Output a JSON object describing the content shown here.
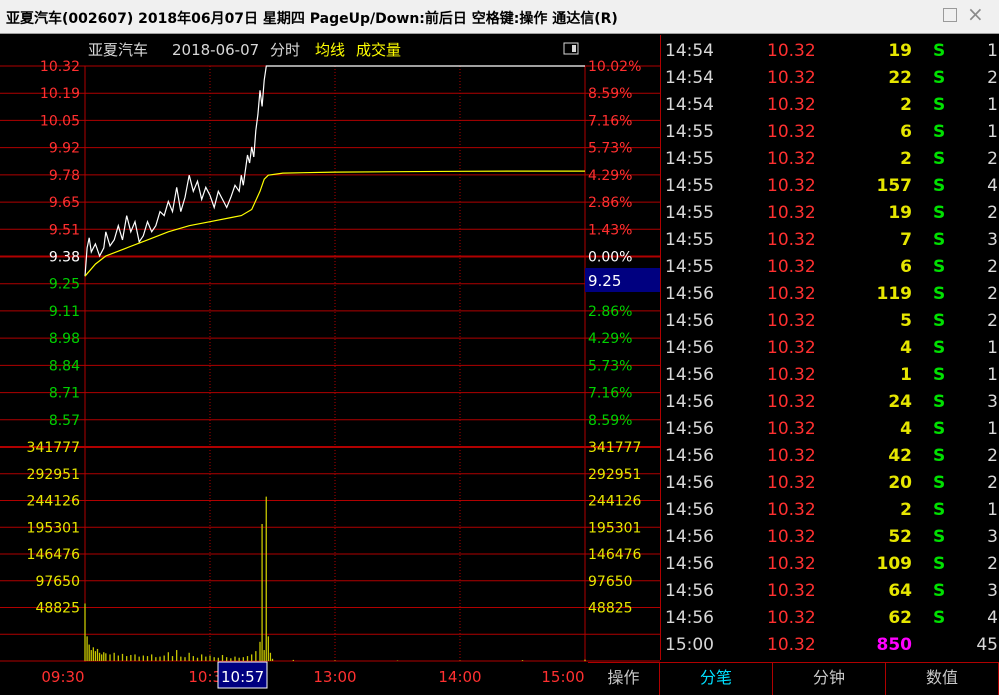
{
  "window": {
    "title": "亚夏汽车(002607) 2018年06月07日 星期四 PageUp/Down:前后日 空格键:操作 通达信(R)",
    "maximize_glyph": "□",
    "close_glyph": "×"
  },
  "chart_header": {
    "stock_name": "亚夏汽车",
    "date": "2018-06-07",
    "mode": "分时",
    "avg_line_label": "均线",
    "volume_label": "成交量"
  },
  "colors": {
    "up": "#ff3030",
    "down": "#00d000",
    "neutral": "#ffffff",
    "avg_line": "#ffff00",
    "grid": "#b00000",
    "volume_bars": "#c8c800",
    "highlight_bg": "#000080",
    "volume_text": "#e6e600",
    "magenta": "#ff00ff"
  },
  "chart_data": {
    "type": "line",
    "title": "亚夏汽车 2018-06-07 分时",
    "prev_close": 9.38,
    "price_ticks_left": [
      "10.32",
      "10.19",
      "10.05",
      "9.92",
      "9.78",
      "9.65",
      "9.51",
      "9.38",
      "9.25",
      "9.11",
      "8.98",
      "8.84",
      "8.71",
      "8.57"
    ],
    "pct_ticks_right": [
      "10.02%",
      "8.59%",
      "7.16%",
      "5.73%",
      "4.29%",
      "2.86%",
      "1.43%",
      "0.00%",
      "1.43%",
      "2.86%",
      "4.29%",
      "5.73%",
      "7.16%",
      "8.59%"
    ],
    "price_range": [
      8.57,
      10.32
    ],
    "volume_ticks": [
      "341777",
      "292951",
      "244126",
      "195301",
      "146476",
      "97650",
      "48825"
    ],
    "volume_range": [
      0,
      390600
    ],
    "time_axis_labels": [
      "09:30",
      "10:30",
      "10:57",
      "13:00",
      "14:00",
      "15:00"
    ],
    "time_axis_minutes": [
      0,
      60,
      87,
      120,
      180,
      240
    ],
    "cursor_time": "10:57",
    "cursor_price": "9.25",
    "series": [
      {
        "name": "price",
        "x": [
          0,
          1,
          2,
          3,
          5,
          7,
          9,
          10,
          12,
          14,
          16,
          18,
          20,
          22,
          24,
          26,
          28,
          30,
          32,
          34,
          36,
          38,
          40,
          42,
          44,
          46,
          48,
          50,
          52,
          54,
          56,
          58,
          60,
          62,
          64,
          66,
          68,
          70,
          72,
          74,
          75,
          76,
          78,
          79,
          80,
          81,
          82,
          83,
          84,
          85,
          86,
          87,
          88,
          240
        ],
        "values": [
          9.28,
          9.42,
          9.47,
          9.4,
          9.44,
          9.38,
          9.42,
          9.5,
          9.43,
          9.46,
          9.53,
          9.46,
          9.58,
          9.5,
          9.55,
          9.45,
          9.48,
          9.55,
          9.5,
          9.53,
          9.6,
          9.58,
          9.65,
          9.6,
          9.72,
          9.6,
          9.67,
          9.78,
          9.7,
          9.75,
          9.66,
          9.72,
          9.68,
          9.62,
          9.7,
          9.66,
          9.62,
          9.67,
          9.73,
          9.7,
          9.78,
          9.73,
          9.88,
          9.84,
          9.92,
          9.87,
          10.0,
          10.08,
          10.2,
          10.12,
          10.25,
          10.32,
          10.32,
          10.32
        ]
      },
      {
        "name": "avg",
        "x": [
          0,
          5,
          10,
          20,
          30,
          40,
          50,
          60,
          70,
          75,
          80,
          84,
          86,
          88,
          95,
          105,
          120,
          150,
          180,
          210,
          240
        ],
        "values": [
          9.28,
          9.34,
          9.38,
          9.42,
          9.46,
          9.5,
          9.53,
          9.55,
          9.57,
          9.58,
          9.61,
          9.7,
          9.76,
          9.78,
          9.79,
          9.792,
          9.795,
          9.797,
          9.799,
          9.8,
          9.8
        ]
      },
      {
        "name": "volume",
        "x": [
          0,
          1,
          2,
          3,
          4,
          5,
          6,
          7,
          8,
          9,
          10,
          12,
          14,
          16,
          18,
          20,
          22,
          24,
          26,
          28,
          30,
          32,
          34,
          36,
          38,
          40,
          42,
          44,
          46,
          48,
          50,
          52,
          54,
          56,
          58,
          60,
          62,
          64,
          66,
          68,
          70,
          72,
          74,
          76,
          78,
          80,
          82,
          84,
          85,
          86,
          87,
          88,
          89,
          90,
          100,
          120,
          150,
          180,
          210,
          240
        ],
        "values": [
          105000,
          45000,
          30000,
          20000,
          25000,
          18000,
          22000,
          15000,
          12000,
          16000,
          14000,
          12000,
          15000,
          10000,
          13000,
          9000,
          11000,
          12000,
          8000,
          10000,
          9000,
          12000,
          7000,
          8000,
          10000,
          16000,
          9000,
          20000,
          8000,
          7000,
          15000,
          9000,
          6000,
          12000,
          8000,
          10000,
          7000,
          6000,
          11000,
          7000,
          5000,
          8000,
          6000,
          7000,
          9000,
          12000,
          18000,
          35000,
          250000,
          20000,
          300000,
          45000,
          15000,
          4000,
          2000,
          1000,
          800,
          600,
          1500,
          2500
        ]
      }
    ]
  },
  "ticks_panel": {
    "rows": [
      {
        "time": "14:54",
        "price": "10.32",
        "volume": "19",
        "dir": "S",
        "count": "1",
        "vcolor": "#e6e600"
      },
      {
        "time": "14:54",
        "price": "10.32",
        "volume": "22",
        "dir": "S",
        "count": "2",
        "vcolor": "#e6e600"
      },
      {
        "time": "14:54",
        "price": "10.32",
        "volume": "2",
        "dir": "S",
        "count": "1",
        "vcolor": "#e6e600"
      },
      {
        "time": "14:55",
        "price": "10.32",
        "volume": "6",
        "dir": "S",
        "count": "1",
        "vcolor": "#e6e600"
      },
      {
        "time": "14:55",
        "price": "10.32",
        "volume": "2",
        "dir": "S",
        "count": "2",
        "vcolor": "#e6e600"
      },
      {
        "time": "14:55",
        "price": "10.32",
        "volume": "157",
        "dir": "S",
        "count": "4",
        "vcolor": "#e6e600"
      },
      {
        "time": "14:55",
        "price": "10.32",
        "volume": "19",
        "dir": "S",
        "count": "2",
        "vcolor": "#e6e600"
      },
      {
        "time": "14:55",
        "price": "10.32",
        "volume": "7",
        "dir": "S",
        "count": "3",
        "vcolor": "#e6e600"
      },
      {
        "time": "14:55",
        "price": "10.32",
        "volume": "6",
        "dir": "S",
        "count": "2",
        "vcolor": "#e6e600"
      },
      {
        "time": "14:56",
        "price": "10.32",
        "volume": "119",
        "dir": "S",
        "count": "2",
        "vcolor": "#e6e600"
      },
      {
        "time": "14:56",
        "price": "10.32",
        "volume": "5",
        "dir": "S",
        "count": "2",
        "vcolor": "#e6e600"
      },
      {
        "time": "14:56",
        "price": "10.32",
        "volume": "4",
        "dir": "S",
        "count": "1",
        "vcolor": "#e6e600"
      },
      {
        "time": "14:56",
        "price": "10.32",
        "volume": "1",
        "dir": "S",
        "count": "1",
        "vcolor": "#e6e600"
      },
      {
        "time": "14:56",
        "price": "10.32",
        "volume": "24",
        "dir": "S",
        "count": "3",
        "vcolor": "#e6e600"
      },
      {
        "time": "14:56",
        "price": "10.32",
        "volume": "4",
        "dir": "S",
        "count": "1",
        "vcolor": "#e6e600"
      },
      {
        "time": "14:56",
        "price": "10.32",
        "volume": "42",
        "dir": "S",
        "count": "2",
        "vcolor": "#e6e600"
      },
      {
        "time": "14:56",
        "price": "10.32",
        "volume": "20",
        "dir": "S",
        "count": "2",
        "vcolor": "#e6e600"
      },
      {
        "time": "14:56",
        "price": "10.32",
        "volume": "2",
        "dir": "S",
        "count": "1",
        "vcolor": "#e6e600"
      },
      {
        "time": "14:56",
        "price": "10.32",
        "volume": "52",
        "dir": "S",
        "count": "3",
        "vcolor": "#e6e600"
      },
      {
        "time": "14:56",
        "price": "10.32",
        "volume": "109",
        "dir": "S",
        "count": "2",
        "vcolor": "#e6e600"
      },
      {
        "time": "14:56",
        "price": "10.32",
        "volume": "64",
        "dir": "S",
        "count": "3",
        "vcolor": "#e6e600"
      },
      {
        "time": "14:56",
        "price": "10.32",
        "volume": "62",
        "dir": "S",
        "count": "4",
        "vcolor": "#e6e600"
      },
      {
        "time": "15:00",
        "price": "10.32",
        "volume": "850",
        "dir": "",
        "count": "45",
        "vcolor": "#ff00ff"
      }
    ]
  },
  "tabs": [
    {
      "label": "操作",
      "active": false
    },
    {
      "label": "分笔",
      "active": true
    },
    {
      "label": "分钟",
      "active": false
    },
    {
      "label": "数值",
      "active": false
    }
  ]
}
